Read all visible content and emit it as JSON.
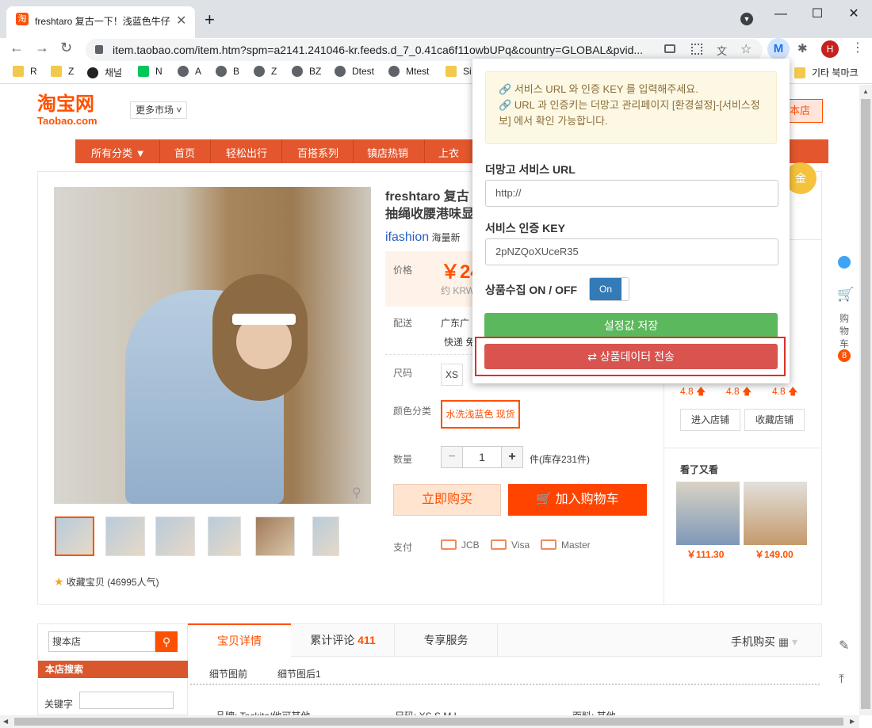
{
  "browser": {
    "tab_title": "freshtaro 复古一下！浅蓝色牛仔",
    "tab_favicon": "淘",
    "url": "item.taobao.com/item.htm?spm=a2141.241046-kr.feeds.d_7_0.41ca6f11owbUPq&country=GLOBAL&pvid...",
    "avatar_letter": "H",
    "bookmarks": [
      "R",
      "Z",
      "채널",
      "N",
      "A",
      "B",
      "Z",
      "BZ",
      "Dtest",
      "Mtest",
      "Si"
    ],
    "bookmarks_right": "기타 북마크"
  },
  "taobao": {
    "logo_cn": "淘宝网",
    "logo_en": "Taobao.com",
    "more_markets": "更多市场",
    "shop_button": "本店",
    "nav": [
      "所有分类 ▼",
      "首页",
      "轻松出行",
      "百搭系列",
      "镇店热销",
      "上衣"
    ],
    "product_title_1": "freshtaro 复古",
    "product_title_2": "抽绳收腰港味显",
    "brand": "ifashion",
    "brand_suffix": "海量新",
    "price_label": "价格",
    "price": "￥24",
    "price_krw": "约 KRW",
    "shipping_label": "配送",
    "shipping_from": "广东广",
    "shipping_express": "快递 免",
    "size_label": "尺码",
    "size_value": "XS",
    "color_label": "颜色分类",
    "color_value": "水洗浅蓝色 现货",
    "qty_label": "数量",
    "qty_minus": "−",
    "qty_value": "1",
    "qty_plus": "+",
    "stock": "件(库存231件)",
    "buy_now": "立即购买",
    "add_cart": "加入购物车",
    "pay_label": "支付",
    "pay_methods": [
      "JCB",
      "Visa",
      "Master"
    ],
    "favorite": "收藏宝贝 (46995人气)",
    "ratings": [
      "4.8",
      "4.8",
      "4.8"
    ],
    "enter_shop": "进入店铺",
    "fav_shop": "收藏店铺",
    "seen_title": "看了又看",
    "seen_prices": [
      "￥111.30",
      "￥149.00"
    ],
    "side_cart": [
      "购",
      "物",
      "车"
    ],
    "cart_count": "8",
    "search_placeholder": "搜本店",
    "shop_search": "本店搜索",
    "keyword_label": "关键字",
    "tabs": [
      "宝贝详情",
      "累计评论",
      "专享服务"
    ],
    "review_count": "411",
    "mobile_buy": "手机购买",
    "detail_tabs": [
      "细节图前",
      "细节图后1"
    ],
    "bottom_row": [
      "品牌: Tackita/他可其他",
      "尺码: XS S M L",
      "面料: 其他"
    ]
  },
  "popup": {
    "info_line1": "서비스 URL 와 인증 KEY 를 입력해주세요.",
    "info_line2": "URL 과 인증키는 더망고 관리페이지 [환경설정]-[서비스정보] 에서 확인 가능합니다.",
    "url_label": "더망고 서비스 URL",
    "url_value": "http://",
    "key_label": "서비스 인증 KEY",
    "key_value": "2pNZQoXUceR35",
    "toggle_label": "상품수집 ON / OFF",
    "toggle_value": "On",
    "save_button": "설정값 저장",
    "send_button": "상품데이터 전송"
  },
  "colors": {
    "taobao_orange": "#ff5000",
    "nav_bar": "#e4572e",
    "save_green": "#5cb85c",
    "send_red": "#d9534f",
    "toggle_blue": "#337ab7"
  }
}
